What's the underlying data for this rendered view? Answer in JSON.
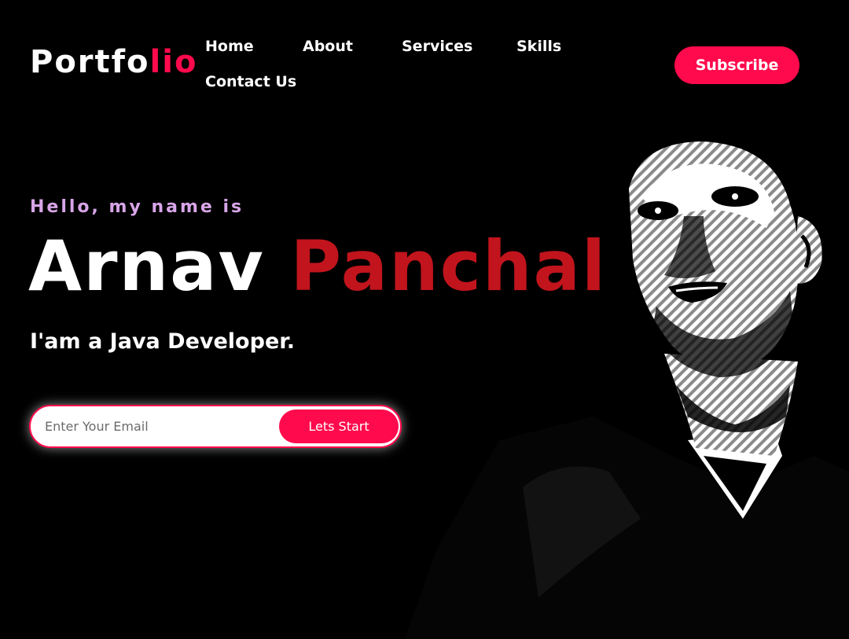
{
  "header": {
    "logo_main": "Portfo",
    "logo_accent": "lio",
    "nav": [
      "Home",
      "About",
      "Services",
      "Skills",
      "Contact Us"
    ],
    "subscribe_label": "Subscribe"
  },
  "hero": {
    "greeting": "Hello, my name is",
    "first_name": "Arnav",
    "last_name": "Panchal",
    "role": "I'am a Java Developer.",
    "email_placeholder": "Enter Your Email",
    "email_value": "",
    "cta_label": "Lets Start"
  },
  "colors": {
    "accent": "#ff0a4c",
    "name_accent": "#c1141c",
    "greeting": "#d8a5e8",
    "background": "#000000"
  }
}
